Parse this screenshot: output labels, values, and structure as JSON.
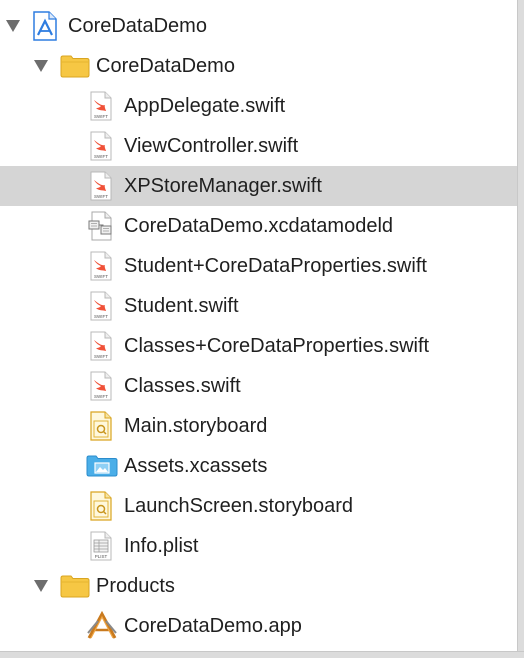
{
  "navigator": {
    "project": {
      "label": "CoreDataDemo",
      "icon": "xcode-project-icon",
      "expanded": true
    },
    "group_main": {
      "label": "CoreDataDemo",
      "icon": "folder-icon",
      "expanded": true
    },
    "files": [
      {
        "label": "AppDelegate.swift",
        "icon": "swift-file-icon",
        "badge": "SWIFT"
      },
      {
        "label": "ViewController.swift",
        "icon": "swift-file-icon",
        "badge": "SWIFT"
      },
      {
        "label": "XPStoreManager.swift",
        "icon": "swift-file-icon",
        "badge": "SWIFT",
        "selected": true
      },
      {
        "label": "CoreDataDemo.xcdatamodeld",
        "icon": "datamodel-file-icon"
      },
      {
        "label": "Student+CoreDataProperties.swift",
        "icon": "swift-file-icon",
        "badge": "SWIFT"
      },
      {
        "label": "Student.swift",
        "icon": "swift-file-icon",
        "badge": "SWIFT"
      },
      {
        "label": "Classes+CoreDataProperties.swift",
        "icon": "swift-file-icon",
        "badge": "SWIFT"
      },
      {
        "label": "Classes.swift",
        "icon": "swift-file-icon",
        "badge": "SWIFT"
      },
      {
        "label": "Main.storyboard",
        "icon": "storyboard-file-icon"
      },
      {
        "label": "Assets.xcassets",
        "icon": "asset-catalog-icon"
      },
      {
        "label": "LaunchScreen.storyboard",
        "icon": "storyboard-file-icon"
      },
      {
        "label": "Info.plist",
        "icon": "plist-file-icon",
        "badge": "PLIST"
      }
    ],
    "group_products": {
      "label": "Products",
      "icon": "folder-icon",
      "expanded": true
    },
    "products": [
      {
        "label": "CoreDataDemo.app",
        "icon": "app-product-icon"
      }
    ]
  },
  "colors": {
    "selection": "#d5d5d5",
    "folder": "#f6c744",
    "swift": "#f05138",
    "project_blue": "#2f7de0",
    "assets_blue": "#4aaee8"
  }
}
